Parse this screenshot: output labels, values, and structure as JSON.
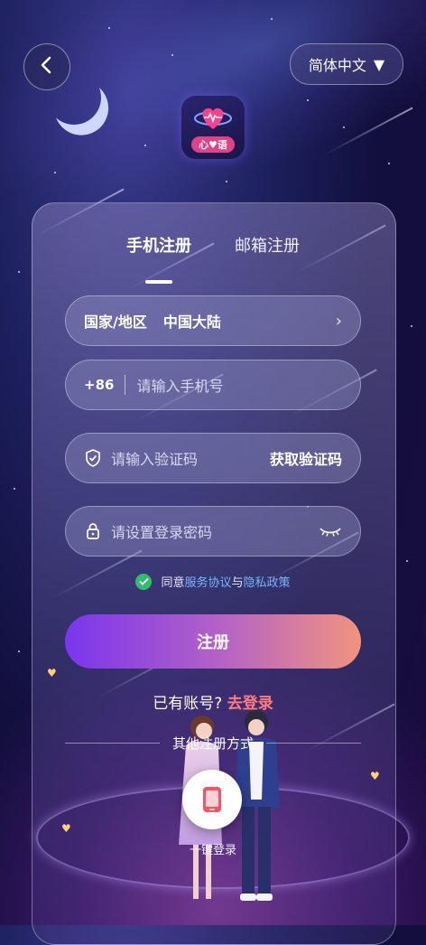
{
  "header": {
    "language_label": "简体中文",
    "language_caret": "▼"
  },
  "logo": {
    "badge_text": "心♥语"
  },
  "tabs": [
    {
      "label": "手机注册",
      "active": true
    },
    {
      "label": "邮箱注册",
      "active": false
    }
  ],
  "form": {
    "region_label": "国家/地区",
    "region_value": "中国大陆",
    "region_chevron": "›",
    "phone_code": "+86",
    "phone_placeholder": "请输入手机号",
    "verify_placeholder": "请输入验证码",
    "get_code_label": "获取验证码",
    "password_placeholder": "请设置登录密码"
  },
  "agreement": {
    "prefix": "同意",
    "terms_link": "服务协议",
    "and": "与",
    "privacy_link": "隐私政策"
  },
  "register_button": "注册",
  "login_prompt": {
    "question": "已有账号?",
    "link": "去登录"
  },
  "other_methods": {
    "title": "其他注册方式",
    "one_click_label": "一键登录"
  },
  "colors": {
    "accent_gradient_start": "#7a35ee",
    "accent_gradient_end": "#f1937e",
    "login_link": "#ff7d7d",
    "policy_link": "#74b6ff",
    "check_green": "#2fbf6a"
  },
  "icons": [
    "back-arrow-icon",
    "shield-check-icon",
    "lock-icon",
    "eye-closed-icon",
    "phone-icon",
    "check-icon"
  ]
}
